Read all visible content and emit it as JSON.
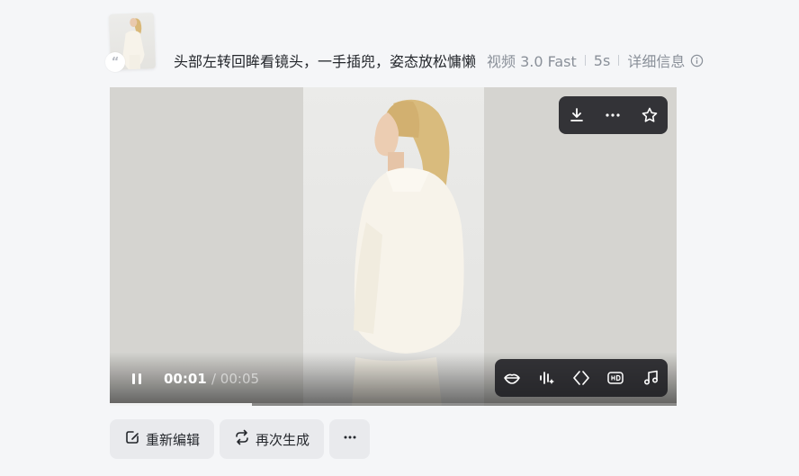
{
  "prompt": {
    "text": "头部左转回眸看镜头，一手插兜，姿态放松慵懒",
    "model": "视频 3.0 Fast",
    "duration": "5s",
    "details_label": "详细信息",
    "quote_mark": "“"
  },
  "player": {
    "current_time": "00:01",
    "total_time": "/ 00:05",
    "progress": 0.25,
    "top_controls": [
      "download-icon",
      "more-icon",
      "star-icon"
    ],
    "bottom_controls": [
      "lips-icon",
      "audio-wave-icon",
      "diamond-arrows-icon",
      "hd-icon",
      "music-note-icon"
    ]
  },
  "actions": {
    "edit_label": "重新编辑",
    "regen_label": "再次生成",
    "more_label": "more"
  }
}
